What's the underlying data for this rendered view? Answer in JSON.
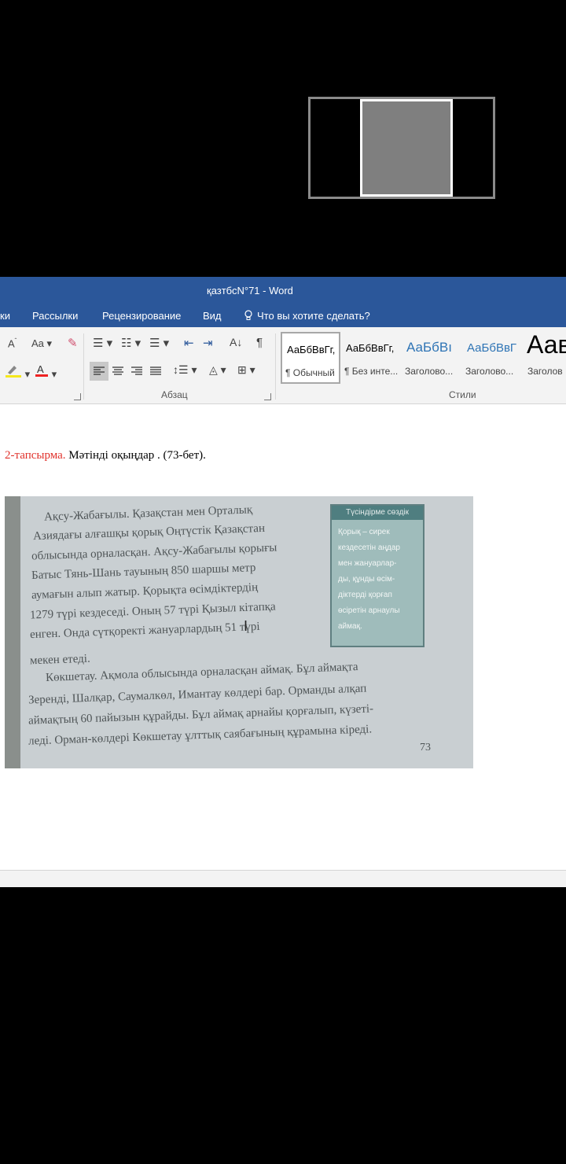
{
  "window": {
    "title": "қазтбсN°71 - Word"
  },
  "tabs": [
    "ки",
    "Рассылки",
    "Рецензирование",
    "Вид"
  ],
  "tell_me": "Что вы хотите сделать?",
  "ribbon": {
    "font_size_up": "A",
    "change_case": "Aa",
    "paragraph_mark": "¶",
    "paragraph_group": "Абзац",
    "styles_group": "Стили",
    "styles": [
      {
        "sample": "АаБбВвГг,",
        "name": "¶ Обычный",
        "color": "#000000"
      },
      {
        "sample": "АаБбВвГг,",
        "name": "¶ Без инте...",
        "color": "#000000"
      },
      {
        "sample": "АаБбВı",
        "name": "Заголово...",
        "color": "#2e74b5"
      },
      {
        "sample": "АаБбВвГ",
        "name": "Заголово...",
        "color": "#2e74b5"
      },
      {
        "sample": "Аав",
        "name": "Заголов",
        "color": "#000000"
      }
    ]
  },
  "document": {
    "task_number": "2-тапсырма.",
    "task_text": " Мәтінді оқыңдар .  (73-бет).",
    "photo": {
      "lines": [
        "Ақсу-Жабағылы. Қазақстан мен Орталық",
        "Азиядағы алғашқы қорық Оңтүстік Қазақстан",
        "облысында орналасқан. Ақсу-Жабағылы қорығы",
        "Батыс Тянь-Шань тауының 850 шаршы метр",
        "аумағын алып жатыр. Қорықта өсімдіктердің",
        "1279 түрі кездеседі. Оның 57 түрі Қызыл кітапқа",
        "енген. Онда сүтқоректі жануарлардың 51 түрі",
        "мекен етеді.",
        "Көкшетау. Ақмола облысында орналасқан аймақ. Бұл аймақта",
        "Зеренді, Шалқар, Саумалкөл, Имантау көлдері бар. Орманды алқап",
        "аймақтың 60 пайызын құрайды. Бұл аймақ арнайы қорғалып, күзеті-",
        "леді. Орман-көлдері Көкшетау ұлттық саябағының құрамына кіреді."
      ],
      "sidebox_title": "Түсіндірме сөздік",
      "sidebox_lines": [
        "Қорық – сирек",
        "кездесетін аңдар",
        "мен жануарлар-",
        "ды, құнды өсім-",
        "діктерді қорғап",
        "өсіретін арнаулы",
        "аймақ."
      ],
      "page_number": "73"
    }
  }
}
